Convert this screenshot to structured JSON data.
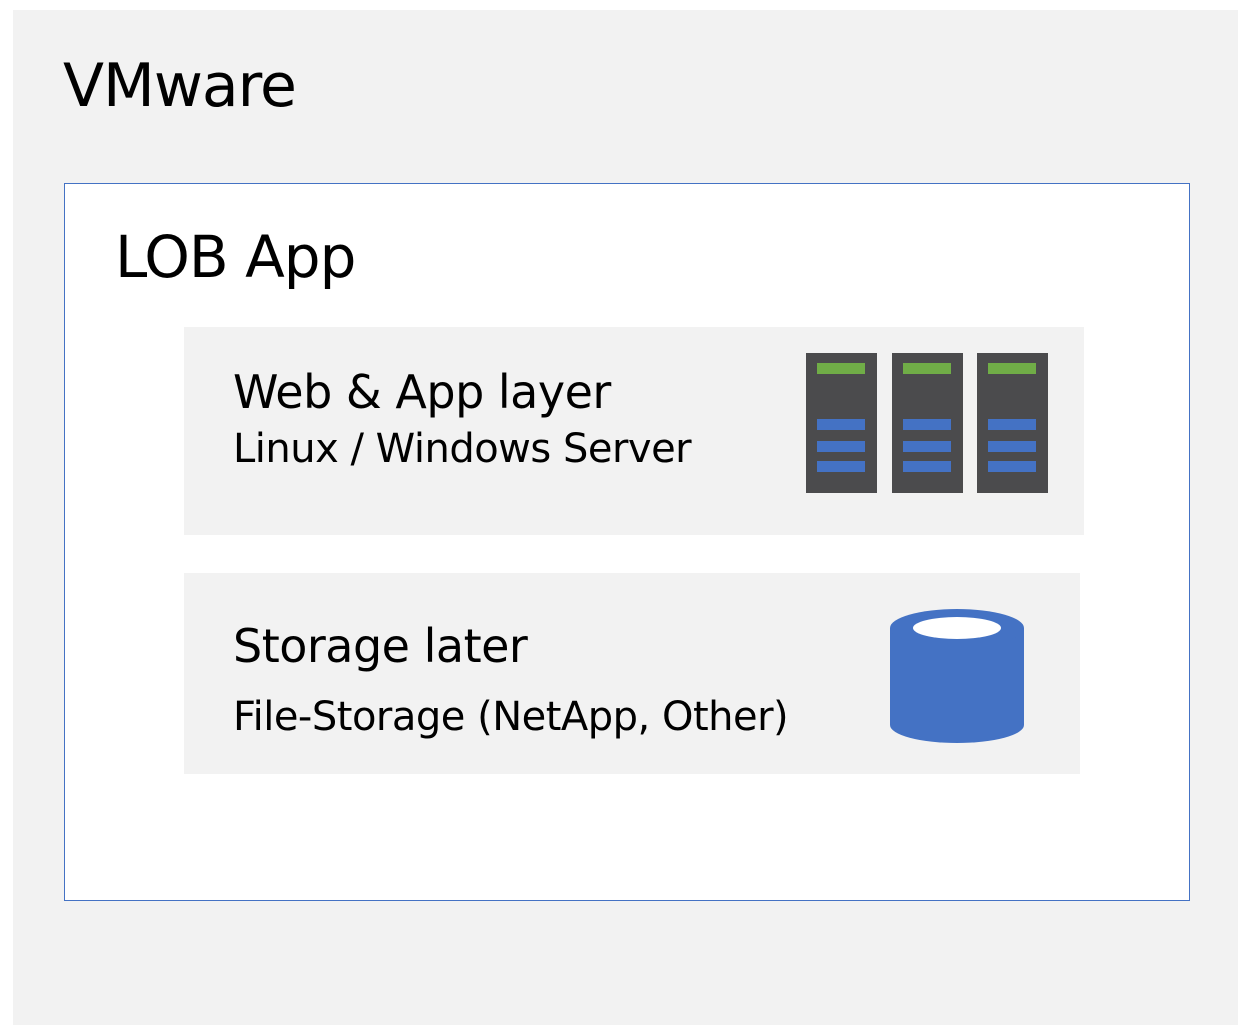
{
  "outer": {
    "title": "VMware"
  },
  "app": {
    "title": "LOB App",
    "layers": [
      {
        "title": "Web & App layer",
        "subtitle": "Linux / Windows Server",
        "icon": "server-rack-icon"
      },
      {
        "title": "Storage later",
        "subtitle": "File-Storage (NetApp, Other)",
        "icon": "database-icon"
      }
    ]
  },
  "colors": {
    "outer_background": "#f2f2f2",
    "box_border": "#4472c4",
    "server_body": "#4b4b4d",
    "server_status": "#70ad47",
    "server_slot": "#4472c4",
    "database": "#4472c4"
  }
}
